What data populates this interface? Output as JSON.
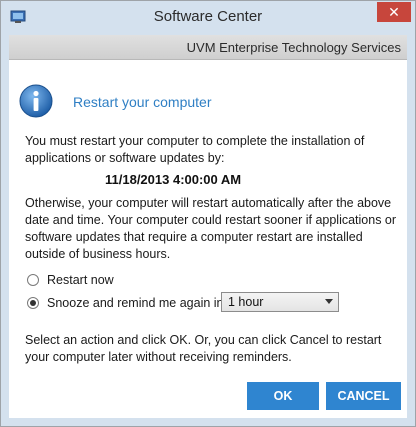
{
  "window": {
    "title": "Software Center",
    "close_glyph": "✕"
  },
  "banner": {
    "text": "UVM Enterprise Technology Services"
  },
  "dialog": {
    "heading": "Restart your computer",
    "message1": "You must restart your computer to complete the installation of applications or software updates by:",
    "deadline": "11/18/2013 4:00:00 AM",
    "message2": "Otherwise, your computer will restart automatically after the above date and time.  Your computer could restart sooner if applications or software updates that require a computer restart are installed outside of business hours.",
    "options": {
      "restart_now": {
        "label": "Restart now",
        "selected": false
      },
      "snooze": {
        "label": "Snooze and remind me again in:",
        "selected": true
      }
    },
    "snooze_select": {
      "value": "1 hour"
    },
    "message3": "Select an action and click OK.  Or, you can click Cancel to restart your computer later without receiving reminders.",
    "buttons": {
      "ok": "OK",
      "cancel": "CANCEL"
    }
  },
  "icons": {
    "app": "software-center-icon",
    "info": "info-icon",
    "dropdown": "chevron-down-icon",
    "close": "close-icon"
  },
  "colors": {
    "accent": "#2f85d0",
    "heading": "#2f7fc4",
    "close": "#c7463c",
    "chrome": "#d4e1ee"
  }
}
